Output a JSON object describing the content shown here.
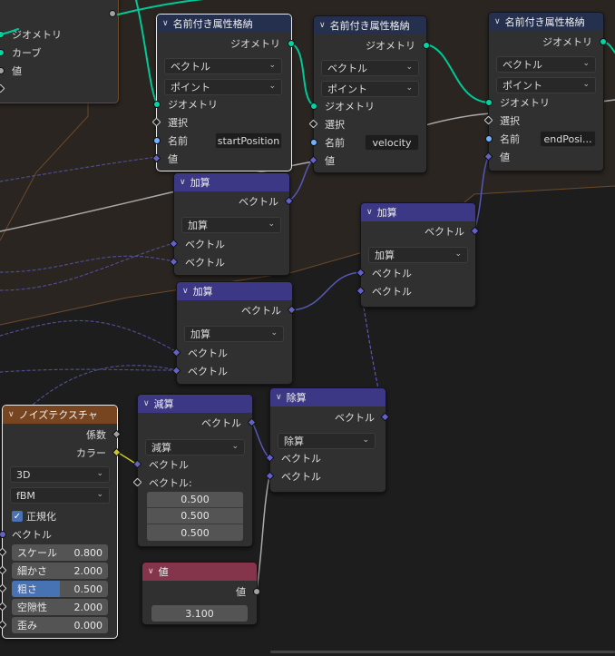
{
  "colors": {
    "geometry_socket": "#00d6a3",
    "vector_socket": "#6363c7",
    "value_socket": "#a1a1a1",
    "string_socket": "#70b2ff",
    "color_socket": "#c7c729",
    "geometry_header": "#24304e",
    "vector_header": "#3d3886",
    "texture_header": "#77451f",
    "input_header": "#84344b",
    "slider_fill": "#4772b3"
  },
  "partial_node": {
    "outputs": [
      "ジオメトリ",
      "カーブ",
      "値"
    ]
  },
  "store_nodes": [
    {
      "title": "名前付き属性格納",
      "output": "ジオメトリ",
      "data_type": "ベクトル",
      "domain": "ポイント",
      "inputs": {
        "geometry": "ジオメトリ",
        "selection": "選択",
        "name": "名前",
        "value": "値"
      },
      "name_value": "startPosition"
    },
    {
      "title": "名前付き属性格納",
      "output": "ジオメトリ",
      "data_type": "ベクトル",
      "domain": "ポイント",
      "inputs": {
        "geometry": "ジオメトリ",
        "selection": "選択",
        "name": "名前",
        "value": "値"
      },
      "name_value": "velocity"
    },
    {
      "title": "名前付き属性格納",
      "output": "ジオメトリ",
      "data_type": "ベクトル",
      "domain": "ポイント",
      "inputs": {
        "geometry": "ジオメトリ",
        "selection": "選択",
        "name": "名前",
        "value": "値"
      },
      "name_value": "endPosi..."
    }
  ],
  "math_nodes": [
    {
      "title": "加算",
      "output": "ベクトル",
      "operation": "加算",
      "in1": "ベクトル",
      "in2": "ベクトル"
    },
    {
      "title": "加算",
      "output": "ベクトル",
      "operation": "加算",
      "in1": "ベクトル",
      "in2": "ベクトル"
    },
    {
      "title": "加算",
      "output": "ベクトル",
      "operation": "加算",
      "in1": "ベクトル",
      "in2": "ベクトル"
    },
    {
      "title": "除算",
      "output": "ベクトル",
      "operation": "除算",
      "in1": "ベクトル",
      "in2": "ベクトル"
    }
  ],
  "subtract_node": {
    "title": "減算",
    "output": "ベクトル",
    "operation": "減算",
    "in1": "ベクトル",
    "in2": "ベクトル:",
    "values": [
      "0.500",
      "0.500",
      "0.500"
    ]
  },
  "noise_node": {
    "title": "ノイズテクスチャ",
    "outputs": {
      "fac": "係数",
      "color": "カラー"
    },
    "dimensions": "3D",
    "type": "fBM",
    "normalize_label": "正規化",
    "normalize_checked": true,
    "vector_label": "ベクトル",
    "params": [
      {
        "label": "スケール",
        "value": "0.800"
      },
      {
        "label": "細かさ",
        "value": "2.000"
      },
      {
        "label": "粗さ",
        "value": "0.500",
        "fill": 0.5
      },
      {
        "label": "空隙性",
        "value": "2.000"
      },
      {
        "label": "歪み",
        "value": "0.000"
      }
    ]
  },
  "value_node": {
    "title": "値",
    "output": "値",
    "value": "3.100"
  }
}
